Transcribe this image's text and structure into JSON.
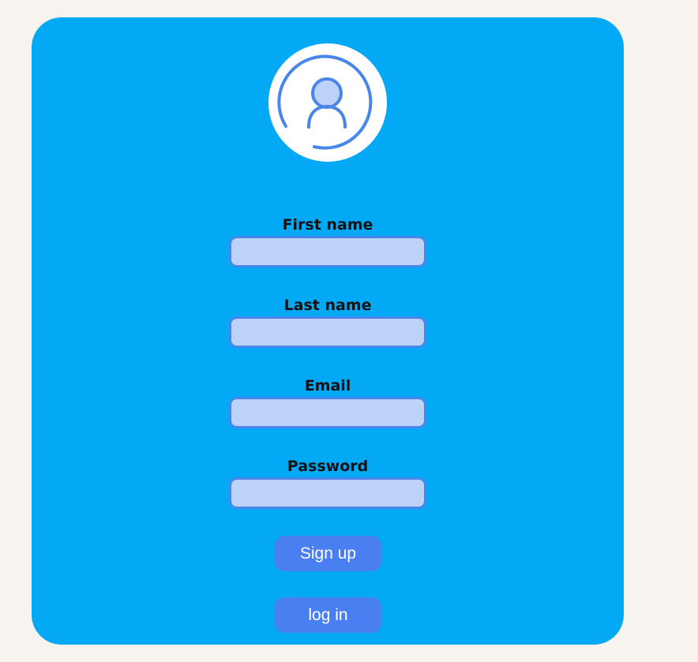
{
  "form": {
    "avatar_icon": "user-icon",
    "fields": [
      {
        "label": "First name",
        "value": "",
        "placeholder": ""
      },
      {
        "label": "Last name",
        "value": "",
        "placeholder": ""
      },
      {
        "label": "Email",
        "value": "",
        "placeholder": ""
      },
      {
        "label": "Password",
        "value": "",
        "placeholder": ""
      }
    ],
    "signup_label": "Sign up",
    "login_label": "log in"
  },
  "colors": {
    "page_background": "#f7f4ef",
    "card_background": "#03a9f4",
    "input_fill": "#bcd2f7",
    "input_border": "#4a86ea",
    "button_fill": "#4a7ff2",
    "avatar_stroke": "#4a86ea"
  }
}
